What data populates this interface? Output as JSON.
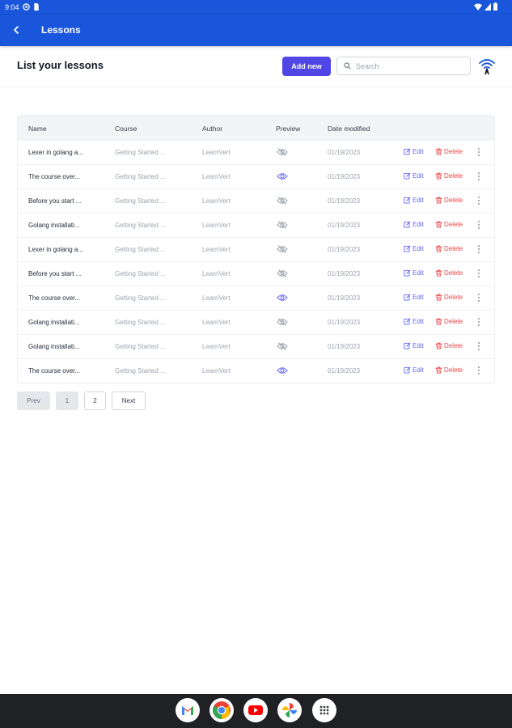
{
  "status_bar": {
    "time": "9:04"
  },
  "app_bar": {
    "title": "Lessons"
  },
  "header": {
    "title": "List your lessons",
    "add_label": "Add new",
    "search_placeholder": "Search"
  },
  "table": {
    "columns": [
      "Name",
      "Course",
      "Author",
      "Preview",
      "Date modified"
    ],
    "edit_label": "Edit",
    "delete_label": "Delete",
    "rows": [
      {
        "name": "Lexer in golang a...",
        "course": "Getting Started ...",
        "author": "LearnVert",
        "preview": false,
        "date": "01/19/2023"
      },
      {
        "name": "The course over...",
        "course": "Getting Started ...",
        "author": "LearnVert",
        "preview": true,
        "date": "01/19/2023"
      },
      {
        "name": "Before you start ...",
        "course": "Getting Started ...",
        "author": "LearnVert",
        "preview": false,
        "date": "01/19/2023"
      },
      {
        "name": "Golang installati...",
        "course": "Getting Started ...",
        "author": "LearnVert",
        "preview": false,
        "date": "01/19/2023"
      },
      {
        "name": "Lexer in golang a...",
        "course": "Getting Started ...",
        "author": "LearnVert",
        "preview": false,
        "date": "01/19/2023"
      },
      {
        "name": "Before you start ...",
        "course": "Getting Started ...",
        "author": "LearnVert",
        "preview": false,
        "date": "01/19/2023"
      },
      {
        "name": "The course over...",
        "course": "Getting Started ...",
        "author": "LearnVert",
        "preview": true,
        "date": "01/19/2023"
      },
      {
        "name": "Golang installati...",
        "course": "Getting Started ...",
        "author": "LearnVert",
        "preview": false,
        "date": "01/19/2023"
      },
      {
        "name": "Golang installati...",
        "course": "Getting Started ...",
        "author": "LearnVert",
        "preview": false,
        "date": "01/19/2023"
      },
      {
        "name": "The course over...",
        "course": "Getting Started ...",
        "author": "LearnVert",
        "preview": true,
        "date": "01/19/2023"
      }
    ]
  },
  "pagination": {
    "prev": "Prev",
    "pages": [
      "1",
      "2"
    ],
    "next": "Next",
    "current": "1"
  },
  "dock_apps": [
    "gmail-icon",
    "chrome-icon",
    "youtube-icon",
    "photos-icon",
    "app-drawer-icon"
  ],
  "colors": {
    "primary": "#1a56db",
    "accent": "#4f46e5",
    "danger": "#ef4444"
  }
}
